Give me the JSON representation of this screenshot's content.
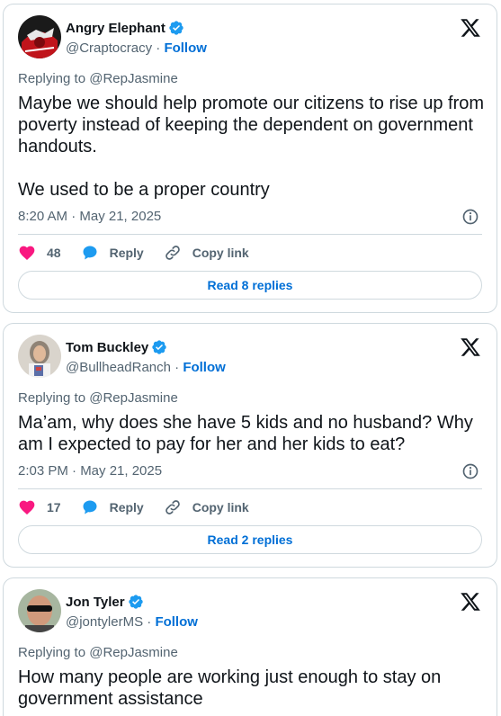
{
  "tweets": [
    {
      "name": "Angry Elephant",
      "handle": "@Craptocracy",
      "follow_label": "Follow",
      "separator": "·",
      "replying": "Replying to @RepJasmine",
      "text": "Maybe we should help promote our citizens to rise up from poverty instead of keeping the dependent on government handouts.\n\nWe used to be a proper country",
      "time": "8:20 AM · May 21, 2025",
      "likes": "48",
      "reply_label": "Reply",
      "copy_label": "Copy link",
      "read_replies": "Read 8 replies"
    },
    {
      "name": "Tom Buckley",
      "handle": "@BullheadRanch",
      "follow_label": "Follow",
      "separator": "·",
      "replying": "Replying to @RepJasmine",
      "text": "Ma’am, why does she have 5 kids and no husband? Why am I expected to pay for her and her kids to eat?",
      "time": "2:03 PM · May 21, 2025",
      "likes": "17",
      "reply_label": "Reply",
      "copy_label": "Copy link",
      "read_replies": "Read 2 replies"
    },
    {
      "name": "Jon Tyler",
      "handle": "@jontylerMS",
      "follow_label": "Follow",
      "separator": "·",
      "replying": "Replying to @RepJasmine",
      "text": "How many people are working just enough to stay on government assistance"
    }
  ],
  "icons": {
    "verified": "verified-badge-icon",
    "x_logo": "x-logo-icon",
    "info": "info-icon",
    "like": "heart-icon",
    "reply": "reply-bubble-icon",
    "copy": "link-icon"
  },
  "colors": {
    "accent": "#1d9bf0",
    "link": "#006fd6",
    "heart": "#f91880",
    "muted": "#536471",
    "border": "#cfd9de"
  }
}
